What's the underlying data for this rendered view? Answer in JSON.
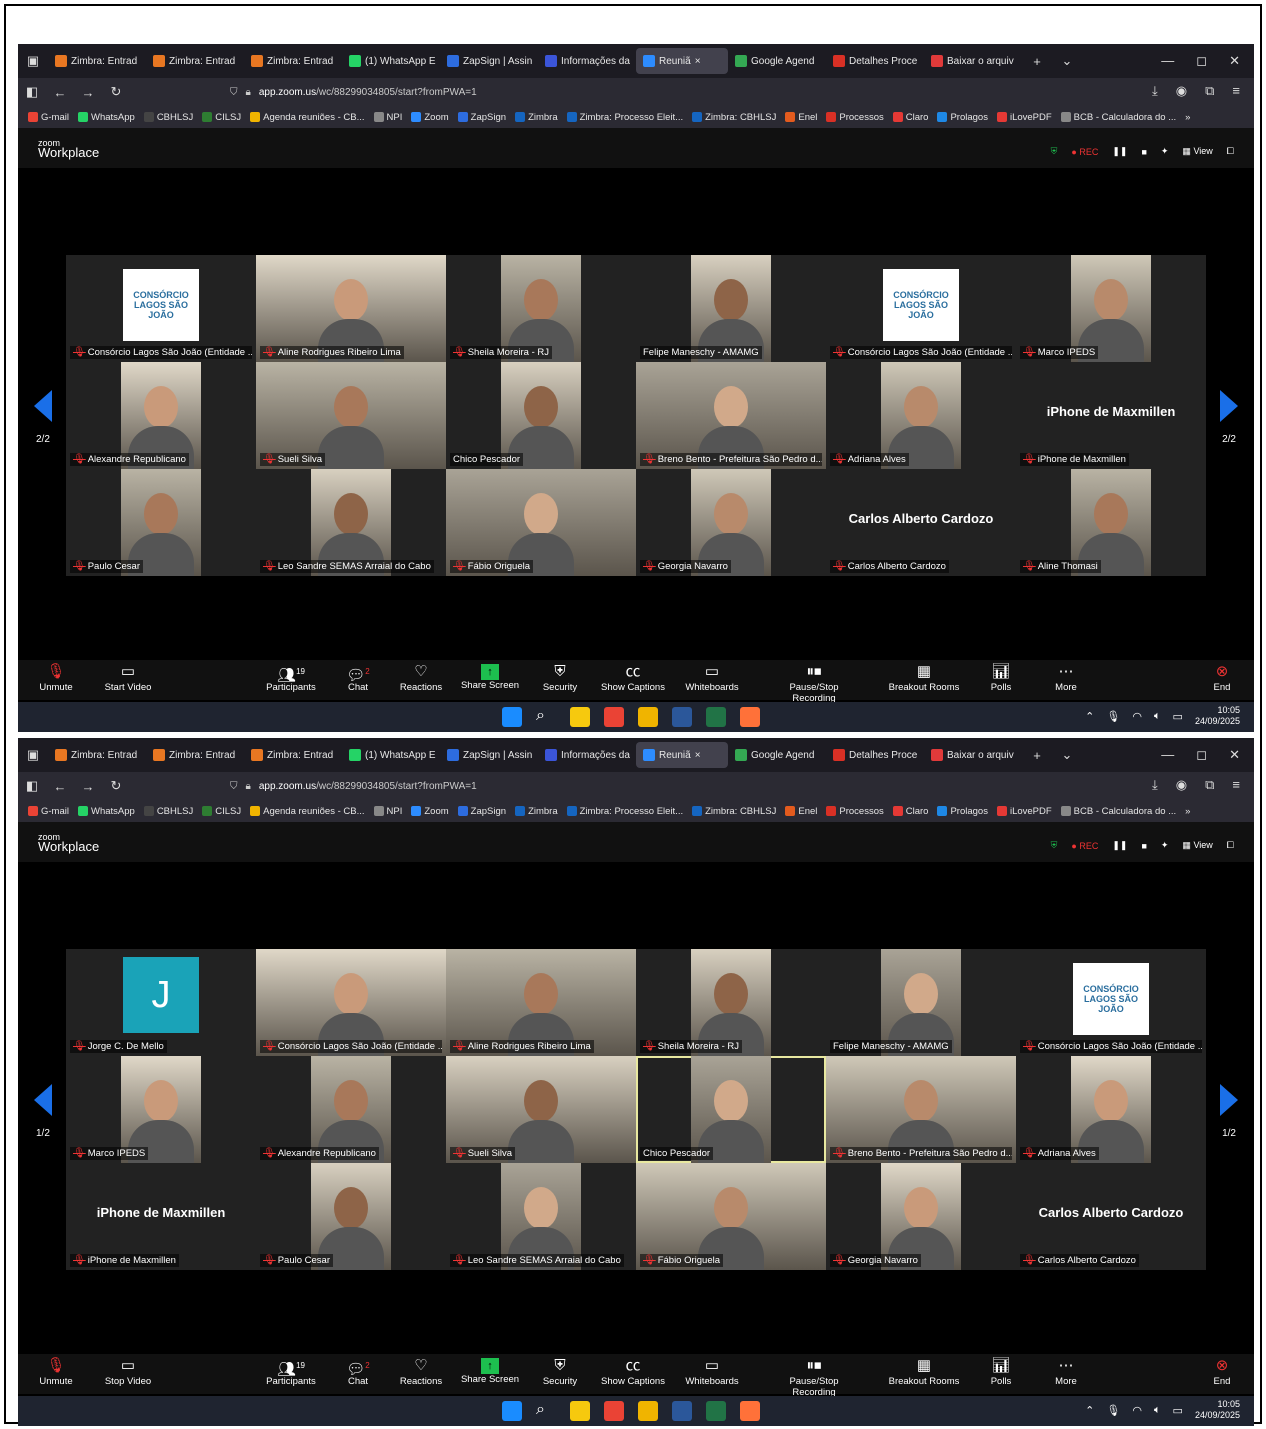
{
  "browser": {
    "tabs": [
      "Zimbra: Entrad",
      "Zimbra: Entrad",
      "Zimbra: Entrad",
      "(1) WhatsApp E",
      "ZapSign | Assin",
      "Informações da",
      "Reuniã",
      "Google Agend",
      "Detalhes Proce",
      "Baixar o arquiv"
    ],
    "tab_colors": [
      "#e87722",
      "#e87722",
      "#e87722",
      "#25d366",
      "#2d6cdf",
      "#3b55d9",
      "#2d8cff",
      "#34a853",
      "#d93025",
      "#e03a3a"
    ],
    "active_tab_close": "×",
    "new_tab": "+",
    "url_domain": "app.zoom.us",
    "url_path_1": "/wc/88299034805/start?fromPWA=1",
    "bookmarks": [
      "G-mail",
      "WhatsApp",
      "CBHLSJ",
      "CILSJ",
      "Agenda reuniões - CB...",
      "NPI",
      "Zoom",
      "ZapSign",
      "Zimbra",
      "Zimbra: Processo Eleit...",
      "Zimbra: CBHLSJ",
      "Enel",
      "Processos",
      "Claro",
      "Prolagos",
      "iLovePDF",
      "BCB - Calculadora do ..."
    ],
    "bookmarks_more": "»"
  },
  "zoom": {
    "logo_top": "zoom",
    "logo_bottom": "Workplace",
    "rec_label": "REC",
    "view_label": "View"
  },
  "shot1": {
    "page_left": "2/2",
    "page_right": "2/2",
    "tiles": [
      {
        "name": "Consórcio Lagos São João (Entidade ...",
        "kind": "logo",
        "muted": true
      },
      {
        "name": "Aline Rodrigues Ribeiro Lima",
        "kind": "wide",
        "muted": true
      },
      {
        "name": "Sheila Moreira - RJ",
        "kind": "video",
        "muted": true
      },
      {
        "name": "Felipe Maneschy - AMAMG",
        "kind": "video",
        "muted": false
      },
      {
        "name": "Consórcio Lagos São João (Entidade ...",
        "kind": "logo",
        "muted": true
      },
      {
        "name": "Marco IPEDS",
        "kind": "video",
        "muted": true
      },
      {
        "name": "Alexandre Republicano",
        "kind": "video",
        "muted": true
      },
      {
        "name": "Sueli Silva",
        "kind": "wide",
        "muted": true
      },
      {
        "name": "Chico Pescador",
        "kind": "video",
        "muted": false
      },
      {
        "name": "Breno Bento - Prefeitura São Pedro d...",
        "kind": "wide",
        "muted": true
      },
      {
        "name": "Adriana Alves",
        "kind": "video",
        "muted": true
      },
      {
        "name": "iPhone de Maxmillen",
        "kind": "text",
        "muted": true
      },
      {
        "name": "Paulo Cesar",
        "kind": "video",
        "muted": true
      },
      {
        "name": "Leo Sandre SEMAS Arraial do Cabo",
        "kind": "video",
        "muted": true
      },
      {
        "name": "Fábio Origuela",
        "kind": "wide",
        "muted": true
      },
      {
        "name": "Georgia Navarro",
        "kind": "video",
        "muted": true
      },
      {
        "name": "Carlos Alberto Cardozo",
        "kind": "text",
        "muted": true
      },
      {
        "name": "Aline Thomasi",
        "kind": "video",
        "muted": true
      }
    ],
    "toolbar_video_label": "Start Video"
  },
  "shot2": {
    "page_left": "1/2",
    "page_right": "1/2",
    "tiles": [
      {
        "name": "Jorge C. De Mello",
        "kind": "avatar",
        "initial": "J",
        "muted": true
      },
      {
        "name": "Consórcio Lagos São João (Entidade ...",
        "kind": "wide",
        "muted": true
      },
      {
        "name": "Aline Rodrigues Ribeiro Lima",
        "kind": "wide",
        "muted": true
      },
      {
        "name": "Sheila Moreira - RJ",
        "kind": "video",
        "muted": true
      },
      {
        "name": "Felipe Maneschy - AMAMG",
        "kind": "video",
        "muted": false
      },
      {
        "name": "Consórcio Lagos São João (Entidade ...",
        "kind": "logo",
        "muted": true
      },
      {
        "name": "Marco IPEDS",
        "kind": "video",
        "muted": true
      },
      {
        "name": "Alexandre Republicano",
        "kind": "video",
        "muted": true
      },
      {
        "name": "Sueli Silva",
        "kind": "wide",
        "muted": true
      },
      {
        "name": "Chico Pescador",
        "kind": "video",
        "muted": false,
        "speaking": true
      },
      {
        "name": "Breno Bento - Prefeitura São Pedro d...",
        "kind": "wide",
        "muted": true
      },
      {
        "name": "Adriana Alves",
        "kind": "video",
        "muted": true
      },
      {
        "name": "iPhone de Maxmillen",
        "kind": "text",
        "muted": true
      },
      {
        "name": "Paulo Cesar",
        "kind": "video",
        "muted": true
      },
      {
        "name": "Leo Sandre SEMAS Arraial do Cabo",
        "kind": "video",
        "muted": true
      },
      {
        "name": "Fábio Origuela",
        "kind": "wide",
        "muted": true
      },
      {
        "name": "Georgia Navarro",
        "kind": "video",
        "muted": true
      },
      {
        "name": "Carlos Alberto Cardozo",
        "kind": "text",
        "muted": true
      }
    ],
    "toolbar_video_label": "Stop Video"
  },
  "toolbar": {
    "unmute": "Unmute",
    "participants": "Participants",
    "participants_count": "19",
    "chat": "Chat",
    "chat_badge": "2",
    "reactions": "Reactions",
    "share_screen": "Share Screen",
    "security": "Security",
    "show_captions": "Show Captions",
    "whiteboards": "Whiteboards",
    "pause_stop_recording": "Pause/Stop Recording",
    "breakout_rooms": "Breakout Rooms",
    "polls": "Polls",
    "more": "More",
    "end": "End"
  },
  "taskbar": {
    "time": "10:05",
    "date": "24/09/2025",
    "app_colors": [
      "#1a8cff",
      "#ffffff",
      "#f6c90e",
      "#ea4335",
      "#f0b400",
      "#2b579a",
      "#217346",
      "#ff7139"
    ]
  },
  "logo_text": "CONSÓRCIO LAGOS SÃO JOÃO"
}
